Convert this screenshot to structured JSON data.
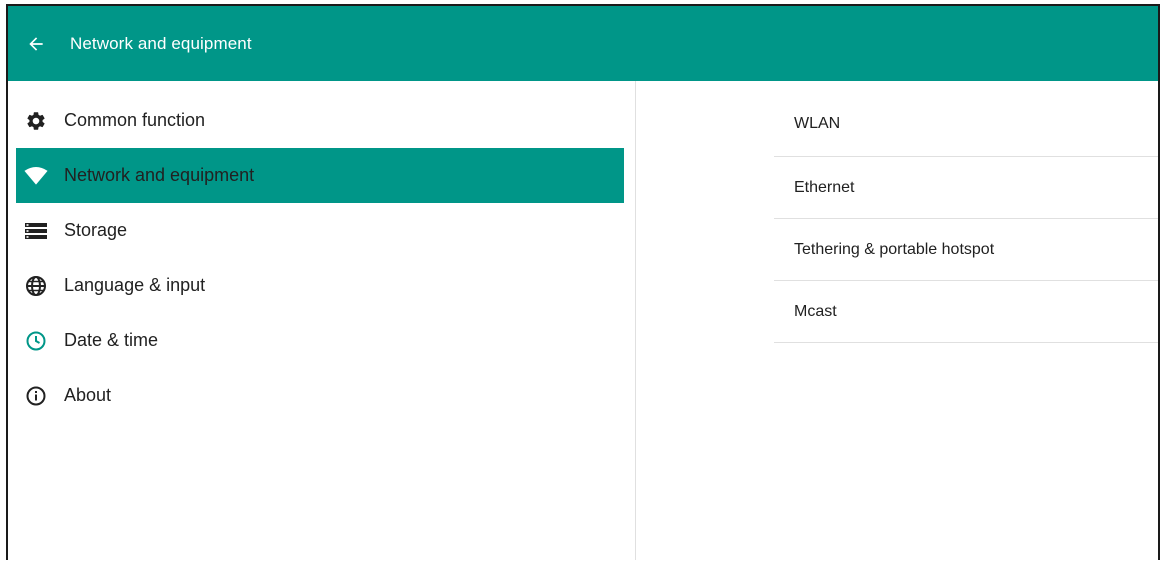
{
  "header": {
    "title": "Network and equipment"
  },
  "sidebar": {
    "items": [
      {
        "label": "Common function",
        "icon": "gear-icon",
        "active": false
      },
      {
        "label": "Network and equipment",
        "icon": "wifi-icon",
        "active": true
      },
      {
        "label": "Storage",
        "icon": "storage-icon",
        "active": false
      },
      {
        "label": "Language & input",
        "icon": "globe-icon",
        "active": false
      },
      {
        "label": "Date & time",
        "icon": "clock-icon",
        "active": false
      },
      {
        "label": "About",
        "icon": "info-icon",
        "active": false
      }
    ]
  },
  "content": {
    "items": [
      {
        "label": "WLAN"
      },
      {
        "label": "Ethernet"
      },
      {
        "label": "Tethering & portable hotspot"
      },
      {
        "label": "Mcast"
      }
    ]
  },
  "colors": {
    "accent": "#009688",
    "text": "#212121",
    "divider": "#e0e0e0"
  }
}
